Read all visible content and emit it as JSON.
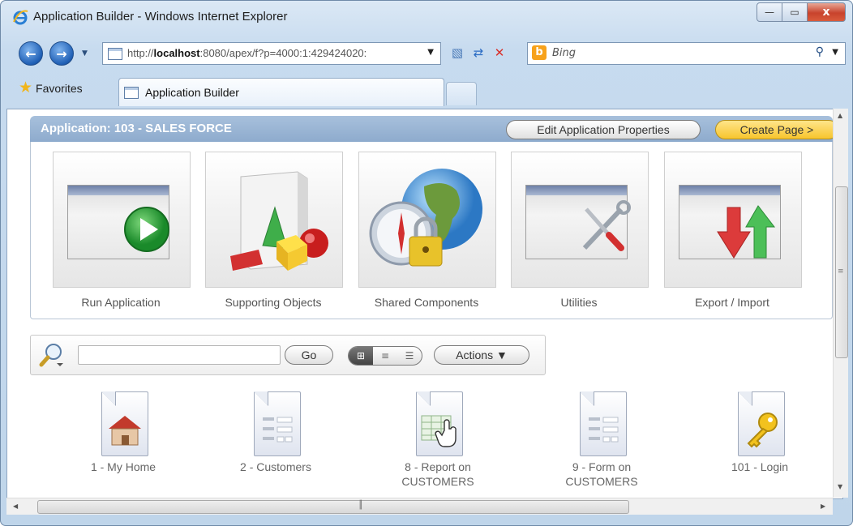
{
  "window": {
    "title": "Application Builder - Windows Internet Explorer",
    "controls": {
      "minimize": "—",
      "maximize": "▭",
      "close": "x"
    }
  },
  "nav": {
    "address_prefix": "http://",
    "address_host": "localhost",
    "address_rest": ":8080/apex/f?p=4000:1:429424020:",
    "search_engine": "Bing",
    "search_placeholder": "Bing"
  },
  "favorites": {
    "label": "Favorites",
    "tab_title": "Application Builder"
  },
  "app": {
    "title": "Application: 103 - SALES FORCE",
    "edit_button": "Edit Application Properties",
    "create_button": "Create Page >"
  },
  "tiles": [
    {
      "label": "Run Application",
      "icon": "run-application-icon"
    },
    {
      "label": "Supporting Objects",
      "icon": "supporting-objects-icon"
    },
    {
      "label": "Shared Components",
      "icon": "shared-components-icon"
    },
    {
      "label": "Utilities",
      "icon": "utilities-icon"
    },
    {
      "label": "Export / Import",
      "icon": "export-import-icon"
    }
  ],
  "toolbar": {
    "search_value": "",
    "go_label": "Go",
    "view_icons": [
      "icons-view",
      "details-view",
      "report-view"
    ],
    "actions_label": "Actions ▼"
  },
  "pages": [
    {
      "label_line1": "1 - My Home",
      "label_line2": "",
      "icon": "home-page-icon"
    },
    {
      "label_line1": "2 - Customers",
      "label_line2": "",
      "icon": "form-page-icon"
    },
    {
      "label_line1": "8 - Report on",
      "label_line2": "CUSTOMERS",
      "icon": "report-page-icon"
    },
    {
      "label_line1": "9 - Form on",
      "label_line2": "CUSTOMERS",
      "icon": "form-page-icon"
    },
    {
      "label_line1": "101 - Login",
      "label_line2": "",
      "icon": "login-page-icon"
    }
  ],
  "colors": {
    "header_blue": "#8eabcd",
    "create_yellow": "#f7c52d",
    "close_red": "#c8432c"
  }
}
